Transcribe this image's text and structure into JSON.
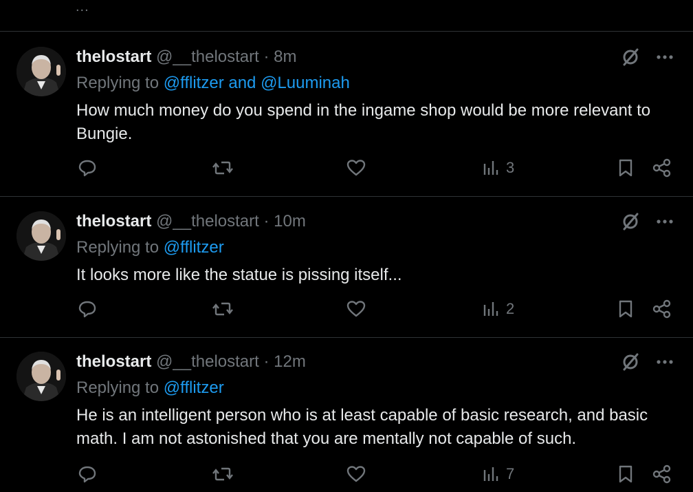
{
  "top_ellipsis": "...",
  "tweets": [
    {
      "name": "thelostart",
      "handle": "@__thelostart",
      "separator": "·",
      "time": "8m",
      "replying_prefix": "Replying to",
      "replying_to": "@fflitzer and @Luuminah",
      "text": "How much money do you spend in the ingame shop would be more relevant to Bungie.",
      "views": "3"
    },
    {
      "name": "thelostart",
      "handle": "@__thelostart",
      "separator": "·",
      "time": "10m",
      "replying_prefix": "Replying to",
      "replying_to": "@fflitzer",
      "text": "It looks more like the statue is pissing itself...",
      "views": "2"
    },
    {
      "name": "thelostart",
      "handle": "@__thelostart",
      "separator": "·",
      "time": "12m",
      "replying_prefix": "Replying to",
      "replying_to": "@fflitzer",
      "text": "He is an intelligent person who is at least capable of basic research, and basic math. I am not astonished that you are mentally not capable of such.",
      "views": "7"
    }
  ],
  "colors": {
    "background": "#000000",
    "text": "#e7e9ea",
    "muted": "#71767b",
    "link": "#1d9bf0",
    "divider": "#2f3336"
  },
  "icons": [
    "reply-icon",
    "repost-icon",
    "like-icon",
    "views-icon",
    "bookmark-icon",
    "share-icon",
    "grok-icon",
    "more-icon"
  ]
}
